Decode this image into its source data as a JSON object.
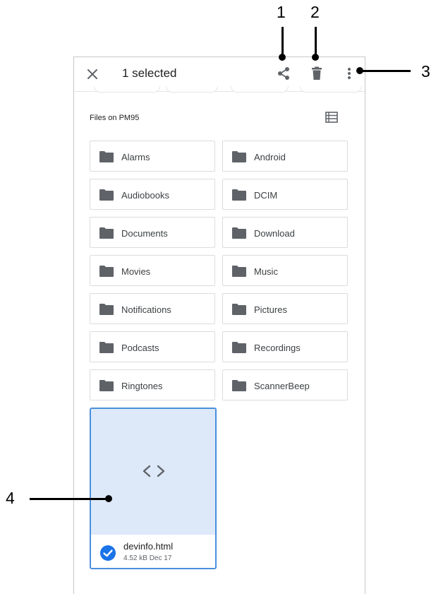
{
  "appbar": {
    "title": "1 selected",
    "icons": {
      "close": "close-icon",
      "share": "share-icon",
      "delete": "delete-icon",
      "more": "more-vert-icon"
    }
  },
  "section": {
    "title": "Files on PM95",
    "view_toggle_icon": "list-view-icon"
  },
  "folders": [
    {
      "label": "Alarms"
    },
    {
      "label": "Android"
    },
    {
      "label": "Audiobooks"
    },
    {
      "label": "DCIM"
    },
    {
      "label": "Documents"
    },
    {
      "label": "Download"
    },
    {
      "label": "Movies"
    },
    {
      "label": "Music"
    },
    {
      "label": "Notifications"
    },
    {
      "label": "Pictures"
    },
    {
      "label": "Podcasts"
    },
    {
      "label": "Recordings"
    },
    {
      "label": "Ringtones"
    },
    {
      "label": "ScannerBeep"
    }
  ],
  "file": {
    "name": "devinfo.html",
    "meta": "4.52 kB Dec 17",
    "selected": true,
    "preview_icon": "code-icon"
  },
  "callouts": [
    "1",
    "2",
    "3",
    "4"
  ],
  "colors": {
    "accent": "#1a73e8",
    "selection_border": "#4a8fdc",
    "selection_bg": "#dde9f9",
    "icon": "#5f6368"
  }
}
